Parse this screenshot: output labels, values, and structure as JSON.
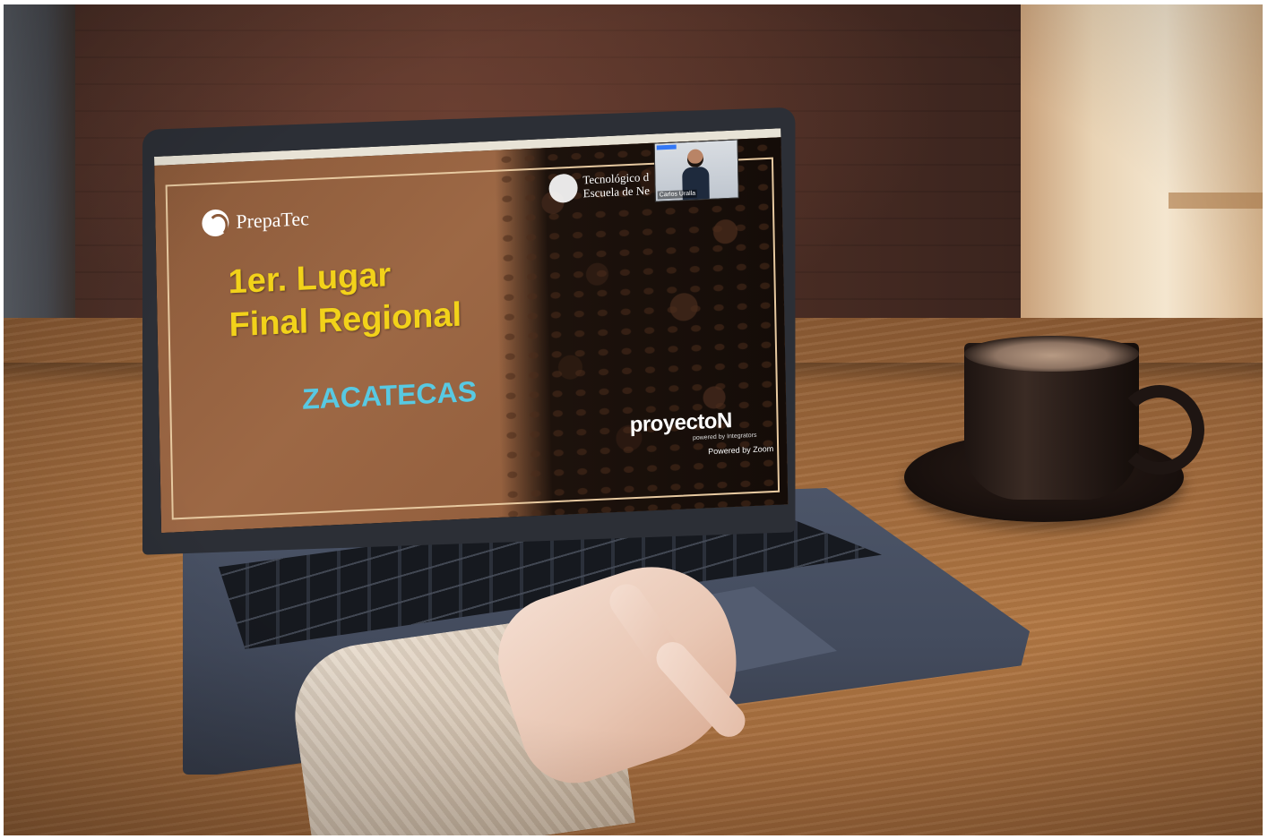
{
  "slide": {
    "brand": "PrepaTec",
    "headline_line1": "1er. Lugar",
    "headline_line2": "Final Regional",
    "city": "ZACATECAS",
    "institution_line1": "Tecnológico d",
    "institution_line2": "Escuela de Ne",
    "logo_main": "proyectoN",
    "logo_sub": "powered by Integrators",
    "powered_by": "Powered by Zoom"
  },
  "video": {
    "participant_name": "Carlos Uralla"
  },
  "colors": {
    "headline": "#f2d21a",
    "city": "#58c9e2",
    "slide_bg": "#8b5a3a"
  }
}
